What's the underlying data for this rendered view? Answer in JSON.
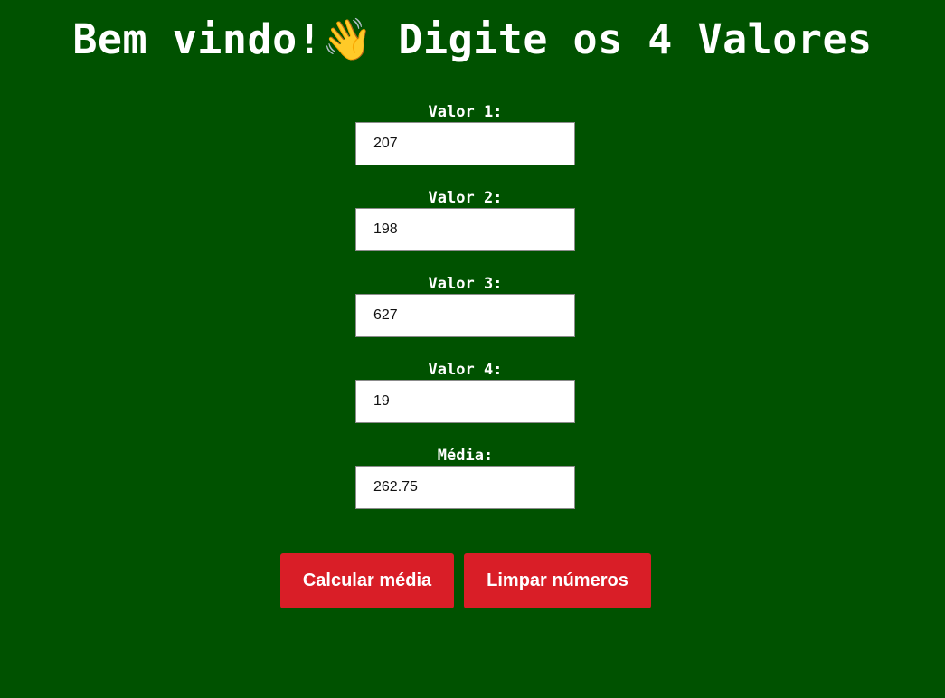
{
  "header": {
    "title": "Bem vindo!👋 Digite os 4 Valores"
  },
  "form": {
    "fields": [
      {
        "label": "Valor 1:",
        "value": "207"
      },
      {
        "label": "Valor 2:",
        "value": "198"
      },
      {
        "label": "Valor 3:",
        "value": "627"
      },
      {
        "label": "Valor 4:",
        "value": "19"
      }
    ],
    "average": {
      "label": "Média:",
      "value": "262.75"
    }
  },
  "buttons": {
    "calculate_label": "Calcular média",
    "clear_label": "Limpar números"
  },
  "colors": {
    "background": "#005200",
    "button": "#d91e27",
    "text": "#ffffff"
  }
}
